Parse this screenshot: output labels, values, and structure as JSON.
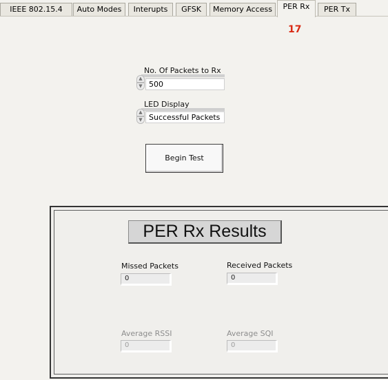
{
  "tabs": [
    {
      "label": "IEEE 802.15.4"
    },
    {
      "label": "Auto Modes"
    },
    {
      "label": "Interupts"
    },
    {
      "label": "GFSK"
    },
    {
      "label": "Memory Access"
    },
    {
      "label": "PER Rx"
    },
    {
      "label": "PER Tx"
    }
  ],
  "active_tab": "PER Rx",
  "counter": "17",
  "packets": {
    "label": "No. Of Packets to Rx",
    "value": "500"
  },
  "led": {
    "label": "LED Display",
    "value": "Successful Packets"
  },
  "begin_button": "Begin Test",
  "results": {
    "title": "PER Rx Results",
    "missed_label": "Missed Packets",
    "missed_value": "0",
    "received_label": "Received Packets",
    "received_value": "0",
    "rssi_label": "Average RSSI",
    "rssi_value": "0",
    "sqi_label": "Average SQI",
    "sqi_value": "0"
  },
  "colors": {
    "counter": "#d92a14",
    "background": "#f3f2ee"
  }
}
